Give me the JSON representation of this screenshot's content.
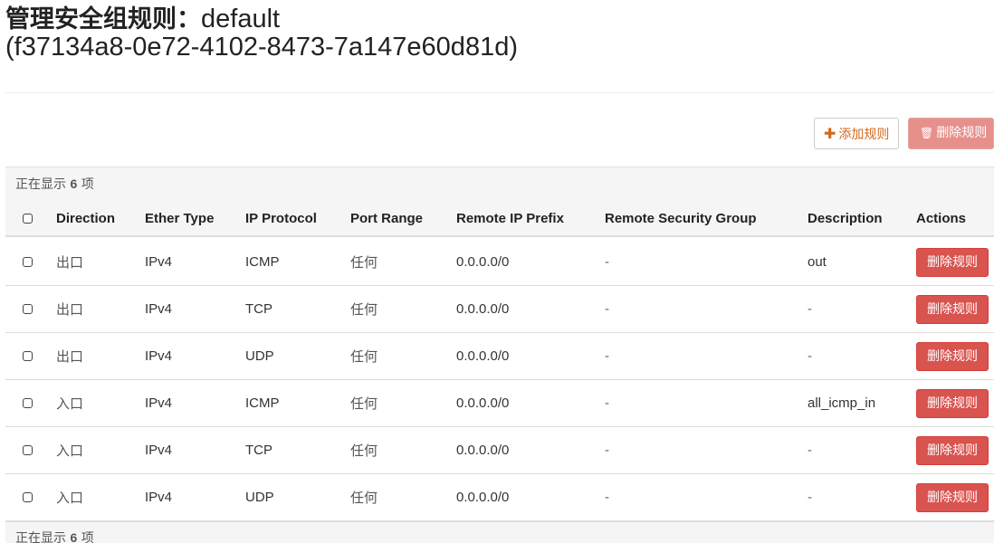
{
  "page": {
    "title_prefix": "管理安全组规则：",
    "group_name": "default",
    "group_id": "(f37134a8-0e72-4102-8473-7a147e60d81d)"
  },
  "toolbar": {
    "add_label": "添加规则",
    "add_icon": "plus-icon",
    "delete_label": "删除规则",
    "delete_icon": "trash-icon"
  },
  "summary": {
    "prefix": "正在显示 ",
    "count": "6",
    "suffix": " 项"
  },
  "table": {
    "columns": [
      "Direction",
      "Ether Type",
      "IP Protocol",
      "Port Range",
      "Remote IP Prefix",
      "Remote Security Group",
      "Description",
      "Actions"
    ],
    "rows": [
      {
        "direction": "出口",
        "ether_type": "IPv4",
        "protocol": "ICMP",
        "port_range": "任何",
        "remote_ip": "0.0.0.0/0",
        "remote_group": "-",
        "description": "out",
        "action": "删除规则"
      },
      {
        "direction": "出口",
        "ether_type": "IPv4",
        "protocol": "TCP",
        "port_range": "任何",
        "remote_ip": "0.0.0.0/0",
        "remote_group": "-",
        "description": "-",
        "action": "删除规则"
      },
      {
        "direction": "出口",
        "ether_type": "IPv4",
        "protocol": "UDP",
        "port_range": "任何",
        "remote_ip": "0.0.0.0/0",
        "remote_group": "-",
        "description": "-",
        "action": "删除规则"
      },
      {
        "direction": "入口",
        "ether_type": "IPv4",
        "protocol": "ICMP",
        "port_range": "任何",
        "remote_ip": "0.0.0.0/0",
        "remote_group": "-",
        "description": "all_icmp_in",
        "action": "删除规则"
      },
      {
        "direction": "入口",
        "ether_type": "IPv4",
        "protocol": "TCP",
        "port_range": "任何",
        "remote_ip": "0.0.0.0/0",
        "remote_group": "-",
        "description": "-",
        "action": "删除规则"
      },
      {
        "direction": "入口",
        "ether_type": "IPv4",
        "protocol": "UDP",
        "port_range": "任何",
        "remote_ip": "0.0.0.0/0",
        "remote_group": "-",
        "description": "-",
        "action": "删除规则"
      }
    ]
  },
  "colors": {
    "danger": "#d9534f",
    "danger_disabled": "#e6908c",
    "accent": "#d2691e",
    "table_header_bg": "#f5f5f5",
    "border": "#dddddd"
  }
}
